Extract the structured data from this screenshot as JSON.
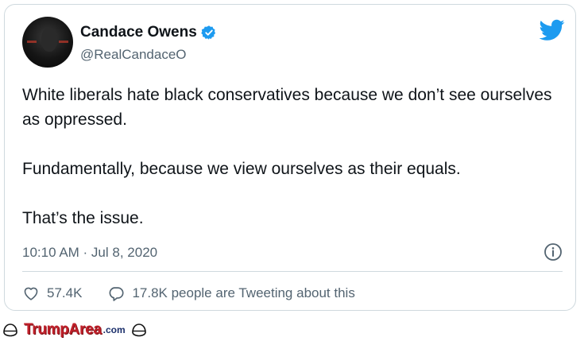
{
  "tweet": {
    "author_name": "Candace Owens",
    "handle": "@RealCandaceO",
    "paragraphs": [
      "White liberals hate black conservatives because we don’t see ourselves as oppressed.",
      "Fundamentally, because we view ourselves as their equals.",
      "That’s the issue."
    ],
    "timestamp": "10:10 AM · Jul 8, 2020",
    "likes": "57.4K",
    "replies_text": "17.8K people are Tweeting about this"
  },
  "footer": {
    "brand": "TrumpArea",
    "brand_suffix": ".com"
  },
  "colors": {
    "twitter_blue": "#1d9bf0",
    "text_primary": "#0f1419",
    "text_secondary": "#536471",
    "brand_red": "#c0202a"
  }
}
